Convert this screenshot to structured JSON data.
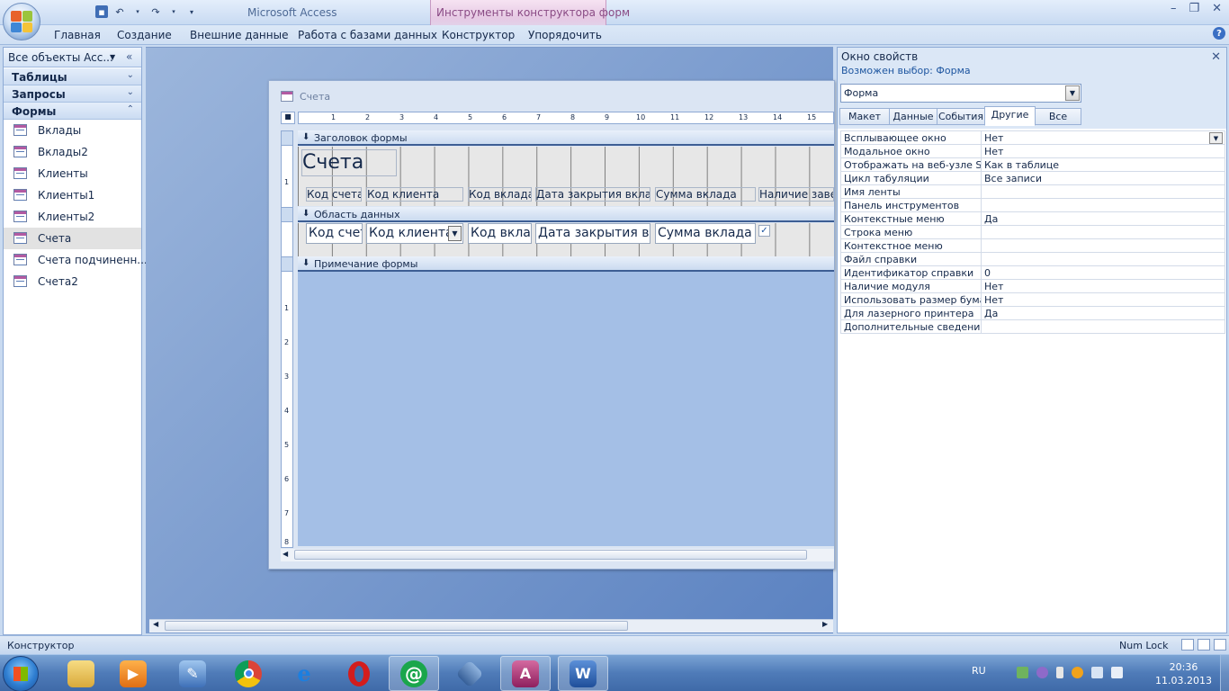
{
  "window": {
    "app_title": "Microsoft Access",
    "context_title": "Инструменты конструктора форм"
  },
  "ribbon": {
    "tabs": [
      "Главная",
      "Создание",
      "Внешние данные",
      "Работа с базами данных",
      "Конструктор",
      "Упорядочить"
    ]
  },
  "nav": {
    "title": "Все объекты Acc...",
    "groups": [
      "Таблицы",
      "Запросы",
      "Формы"
    ],
    "forms": [
      "Вклады",
      "Вклады2",
      "Клиенты",
      "Клиенты1",
      "Клиенты2",
      "Счета",
      "Счета подчиненн...",
      "Счета2"
    ],
    "selected": "Счета"
  },
  "form": {
    "window_title": "Счета",
    "header_section": "Заголовок формы",
    "detail_section": "Область данных",
    "footer_section": "Примечание формы",
    "header_title": "Счета",
    "header_labels": [
      "Код счета",
      "Код клиента",
      "Код вклада",
      "Дата закрытия вклада",
      "Сумма вклада",
      "Наличие завещ"
    ],
    "detail_fields": [
      "Код счет",
      "Код клиента",
      "Код вклад",
      "Дата закрытия вк",
      "Сумма вклада"
    ],
    "ruler_marks": [
      "1",
      "2",
      "3",
      "4",
      "5",
      "6",
      "7",
      "8",
      "9",
      "10",
      "11",
      "12",
      "13",
      "14",
      "15"
    ],
    "left_ruler_marks": [
      "1",
      "1",
      "2",
      "3",
      "4",
      "5",
      "6",
      "7",
      "8"
    ]
  },
  "properties": {
    "title": "Окно свойств",
    "selection_label": "Возможен выбор:  Форма",
    "object": "Форма",
    "tabs": [
      "Макет",
      "Данные",
      "События",
      "Другие",
      "Все"
    ],
    "active_tab": "Другие",
    "rows": [
      {
        "k": "Всплывающее окно",
        "v": "Нет"
      },
      {
        "k": "Модальное окно",
        "v": "Нет"
      },
      {
        "k": "Отображать на веб-узле Sha",
        "v": "Как в таблице"
      },
      {
        "k": "Цикл табуляции",
        "v": "Все записи"
      },
      {
        "k": "Имя ленты",
        "v": ""
      },
      {
        "k": "Панель инструментов",
        "v": ""
      },
      {
        "k": "Контекстные меню",
        "v": "Да"
      },
      {
        "k": "Строка меню",
        "v": ""
      },
      {
        "k": "Контекстное меню",
        "v": ""
      },
      {
        "k": "Файл справки",
        "v": ""
      },
      {
        "k": "Идентификатор справки",
        "v": "0"
      },
      {
        "k": "Наличие модуля",
        "v": "Нет"
      },
      {
        "k": "Использовать размер бумаги",
        "v": "Нет"
      },
      {
        "k": "Для лазерного принтера",
        "v": "Да"
      },
      {
        "k": "Дополнительные сведения",
        "v": ""
      }
    ]
  },
  "status": {
    "mode": "Конструктор",
    "numlock": "Num Lock"
  },
  "taskbar": {
    "lang": "RU",
    "time": "20:36",
    "date": "11.03.2013",
    "apps": [
      "explorer-icon",
      "media-player-icon",
      "tools-icon",
      "chrome-icon",
      "ie-icon",
      "opera-icon",
      "mail-agent-icon",
      "virtualbox-icon",
      "access-icon",
      "word-icon"
    ]
  }
}
